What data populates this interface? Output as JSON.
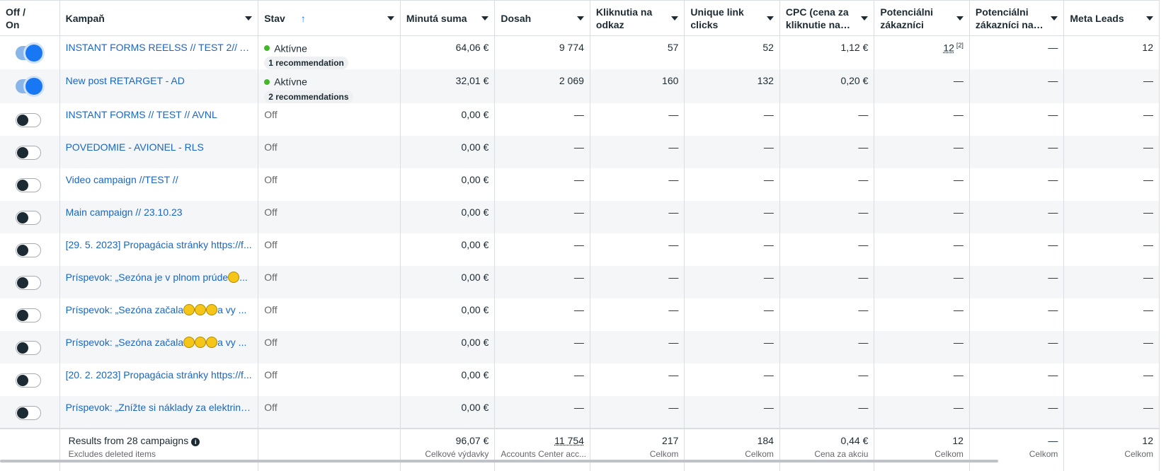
{
  "columns": [
    {
      "key": "toggle",
      "label": "Off / On"
    },
    {
      "key": "name",
      "label": "Kampaň"
    },
    {
      "key": "status",
      "label": "Stav",
      "sort": "↑"
    },
    {
      "key": "spend",
      "label": "Minutá suma"
    },
    {
      "key": "reach",
      "label": "Dosah"
    },
    {
      "key": "clicks",
      "label": "Kliknutia na odkaz"
    },
    {
      "key": "unique",
      "label": "Unique link clicks"
    },
    {
      "key": "cpc",
      "label": "CPC (cena za kliknutie na…"
    },
    {
      "key": "pot",
      "label": "Potenciálni zákazníci"
    },
    {
      "key": "pot2",
      "label": "Potenciálni zákazníci na…"
    },
    {
      "key": "leads",
      "label": "Meta Leads"
    }
  ],
  "rows": [
    {
      "on": true,
      "name": "INSTANT FORMS REELSS // TEST 2// AVI...",
      "status": "Aktívne",
      "reco": "1 recommendation",
      "spend": "64,06 €",
      "reach": "9 774",
      "clicks": "57",
      "unique": "52",
      "cpc": "1,12 €",
      "pot": "12",
      "pot_note": "[2]",
      "pot2": "—",
      "leads": "12"
    },
    {
      "on": true,
      "name": "New post RETARGET - AD",
      "status": "Aktívne",
      "reco": "2 recommendations",
      "spend": "32,01 €",
      "reach": "2 069",
      "clicks": "160",
      "unique": "132",
      "cpc": "0,20 €",
      "pot": "—",
      "pot2": "—",
      "leads": "—"
    },
    {
      "on": false,
      "name": "INSTANT FORMS // TEST // AVNL",
      "status": "Off",
      "spend": "0,00 €",
      "reach": "—",
      "clicks": "—",
      "unique": "—",
      "cpc": "—",
      "pot": "—",
      "pot2": "—",
      "leads": "—"
    },
    {
      "on": false,
      "name": "POVEDOMIE - AVIONEL - RLS",
      "status": "Off",
      "spend": "0,00 €",
      "reach": "—",
      "clicks": "—",
      "unique": "—",
      "cpc": "—",
      "pot": "—",
      "pot2": "—",
      "leads": "—"
    },
    {
      "on": false,
      "name": "Video campaign //TEST //",
      "status": "Off",
      "spend": "0,00 €",
      "reach": "—",
      "clicks": "—",
      "unique": "—",
      "cpc": "—",
      "pot": "—",
      "pot2": "—",
      "leads": "—"
    },
    {
      "on": false,
      "name": "Main campaign // 23.10.23",
      "status": "Off",
      "spend": "0,00 €",
      "reach": "—",
      "clicks": "—",
      "unique": "—",
      "cpc": "—",
      "pot": "—",
      "pot2": "—",
      "leads": "—"
    },
    {
      "on": false,
      "name": "[29. 5. 2023] Propagácia stránky https://f...",
      "status": "Off",
      "spend": "0,00 €",
      "reach": "—",
      "clicks": "—",
      "unique": "—",
      "cpc": "—",
      "pot": "—",
      "pot2": "—",
      "leads": "—"
    },
    {
      "on": false,
      "name_parts": [
        "Príspevok: „Sezóna je v plnom prúde",
        "..."
      ],
      "suns": 1,
      "status": "Off",
      "spend": "0,00 €",
      "reach": "—",
      "clicks": "—",
      "unique": "—",
      "cpc": "—",
      "pot": "—",
      "pot2": "—",
      "leads": "—"
    },
    {
      "on": false,
      "name_parts": [
        "Príspevok: „Sezóna začala",
        "a vy ..."
      ],
      "suns": 3,
      "status": "Off",
      "spend": "0,00 €",
      "reach": "—",
      "clicks": "—",
      "unique": "—",
      "cpc": "—",
      "pot": "—",
      "pot2": "—",
      "leads": "—"
    },
    {
      "on": false,
      "name_parts": [
        "Príspevok: „Sezóna začala",
        "a vy ..."
      ],
      "suns": 3,
      "status": "Off",
      "spend": "0,00 €",
      "reach": "—",
      "clicks": "—",
      "unique": "—",
      "cpc": "—",
      "pot": "—",
      "pot2": "—",
      "leads": "—"
    },
    {
      "on": false,
      "name": "[20. 2. 2023] Propagácia stránky https://f...",
      "status": "Off",
      "spend": "0,00 €",
      "reach": "—",
      "clicks": "—",
      "unique": "—",
      "cpc": "—",
      "pot": "—",
      "pot2": "—",
      "leads": "—"
    },
    {
      "on": false,
      "name": "Príspevok: „Znížte si náklady za elektrinu...",
      "status": "Off",
      "spend": "0,00 €",
      "reach": "—",
      "clicks": "—",
      "unique": "—",
      "cpc": "—",
      "pot": "—",
      "pot2": "—",
      "leads": "—"
    }
  ],
  "footer": {
    "summary": "Results from 28 campaigns",
    "summary_sub": "Excludes deleted items",
    "spend": "96,07 €",
    "spend_sub": "Celkové výdavky",
    "reach": "11 754",
    "reach_sub": "Accounts Center acc...",
    "clicks": "217",
    "clicks_sub": "Celkom",
    "unique": "184",
    "unique_sub": "Celkom",
    "cpc": "0,44 €",
    "cpc_sub": "Cena za akciu",
    "pot": "12",
    "pot_sub": "Celkom",
    "pot2": "—",
    "pot2_sub": "Celkom",
    "leads": "12",
    "leads_sub": "Celkom"
  },
  "colors": {
    "link": "#1a66c4",
    "active_dot": "#42b72a",
    "toggle_on": "#1877f2",
    "row_alt": "#f5f6f7"
  },
  "icons": {
    "sort": "arrow-up-icon",
    "caret": "caret-down-icon",
    "info": "info-icon",
    "sun": "sun-emoji-icon"
  }
}
